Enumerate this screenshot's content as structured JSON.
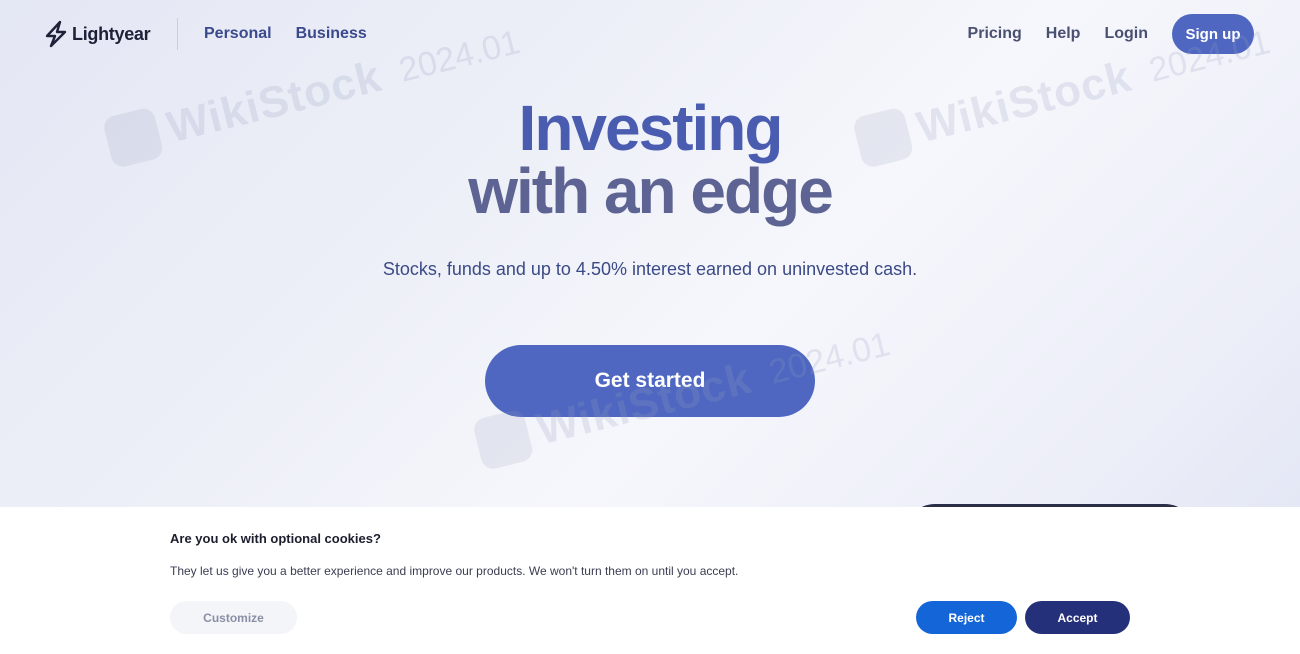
{
  "header": {
    "logo_text": "Lightyear",
    "nav_left": [
      "Personal",
      "Business"
    ],
    "nav_right": [
      "Pricing",
      "Help",
      "Login"
    ],
    "signup_label": "Sign up"
  },
  "hero": {
    "title_line1": "Investing",
    "title_line2": "with an edge",
    "subtitle": "Stocks, funds and up to 4.50% interest earned on uninvested cash.",
    "cta_label": "Get started"
  },
  "watermark": {
    "name": "WikiStock",
    "date": "2024.01"
  },
  "cookie_banner": {
    "title": "Are you ok with optional cookies?",
    "text": "They let us give you a better experience and improve our products. We won't turn them on until you accept.",
    "customize_label": "Customize",
    "reject_label": "Reject",
    "accept_label": "Accept"
  },
  "colors": {
    "brand": "#4f67c0",
    "reject": "#1466d8",
    "accept": "#25307a"
  }
}
